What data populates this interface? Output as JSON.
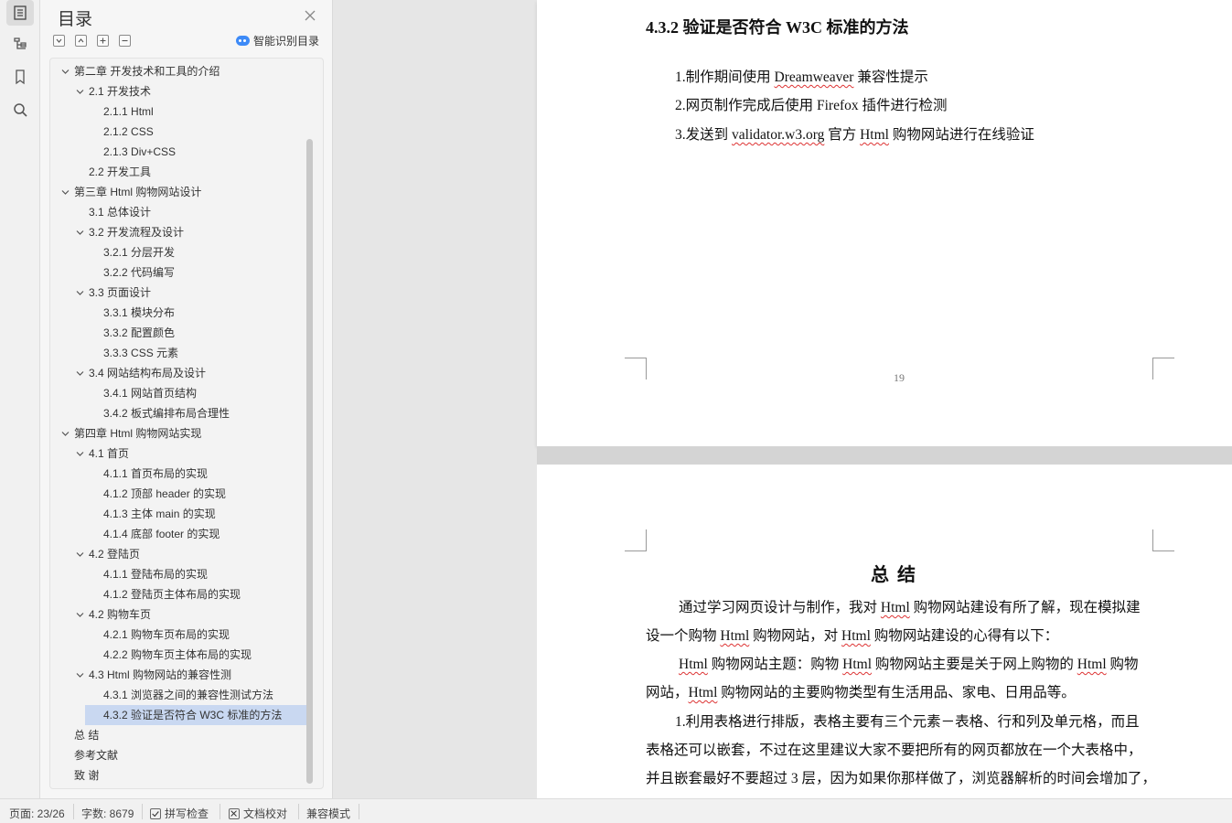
{
  "toc": {
    "title": "目录",
    "smart_label": "智能识别目录",
    "items": [
      {
        "label": "第二章  开发技术和工具的介绍",
        "level": 0,
        "expanded": true
      },
      {
        "label": "2.1 开发技术",
        "level": 1,
        "expanded": true
      },
      {
        "label": "2.1.1 Html",
        "level": 2
      },
      {
        "label": "2.1.2 CSS",
        "level": 2
      },
      {
        "label": "2.1.3 Div+CSS",
        "level": 2
      },
      {
        "label": "2.2 开发工具",
        "level": 1
      },
      {
        "label": "第三章  Html 购物网站设计",
        "level": 0,
        "expanded": true
      },
      {
        "label": "3.1 总体设计",
        "level": 1
      },
      {
        "label": "3.2 开发流程及设计",
        "level": 1,
        "expanded": true
      },
      {
        "label": "3.2.1  分层开发",
        "level": 2
      },
      {
        "label": "3.2.2  代码编写",
        "level": 2
      },
      {
        "label": "3.3 页面设计",
        "level": 1,
        "expanded": true
      },
      {
        "label": "3.3.1 模块分布",
        "level": 2
      },
      {
        "label": "3.3.2  配置颜色",
        "level": 2
      },
      {
        "label": "3.3.3 CSS 元素",
        "level": 2
      },
      {
        "label": "3.4 网站结构布局及设计",
        "level": 1,
        "expanded": true
      },
      {
        "label": "3.4.1  网站首页结构",
        "level": 2
      },
      {
        "label": "3.4.2  板式编排布局合理性",
        "level": 2
      },
      {
        "label": "第四章  Html 购物网站实现",
        "level": 0,
        "expanded": true
      },
      {
        "label": "4.1 首页",
        "level": 1,
        "expanded": true
      },
      {
        "label": "4.1.1 首页布局的实现",
        "level": 2
      },
      {
        "label": "4.1.2  顶部 header 的实现",
        "level": 2
      },
      {
        "label": "4.1.3  主体 main 的实现",
        "level": 2
      },
      {
        "label": "4.1.4  底部 footer 的实现",
        "level": 2
      },
      {
        "label": "4.2  登陆页",
        "level": 1,
        "expanded": true
      },
      {
        "label": "4.1.1 登陆布局的实现",
        "level": 2
      },
      {
        "label": "4.1.2 登陆页主体布局的实现",
        "level": 2
      },
      {
        "label": "4.2  购物车页",
        "level": 1,
        "expanded": true
      },
      {
        "label": "4.2.1 购物车页布局的实现",
        "level": 2
      },
      {
        "label": "4.2.2 购物车页主体布局的实现",
        "level": 2
      },
      {
        "label": "4.3 Html 购物网站的兼容性测",
        "level": 1,
        "expanded": true
      },
      {
        "label": "4.3.1 浏览器之间的兼容性测试方法",
        "level": 2
      },
      {
        "label": "4.3.2 验证是否符合 W3C 标准的方法",
        "level": 2,
        "selected": true
      },
      {
        "label": "总   结",
        "level": 0,
        "leaf": true
      },
      {
        "label": "参考文献",
        "level": 0,
        "leaf": true
      },
      {
        "label": "致   谢",
        "level": 0,
        "leaf": true
      }
    ]
  },
  "page1": {
    "heading": "4.3.2 验证是否符合 W3C 标准的方法",
    "line1": {
      "a": "1.制作期间使用 ",
      "b": "Dreamweaver",
      "c": " 兼容性提示"
    },
    "line2": "2.网页制作完成后使用 Firefox 插件进行检测",
    "line3": {
      "a": "3.发送到 ",
      "b": "validator.w3.org",
      "c": " 官方 ",
      "d": "Html",
      "e": " 购物网站进行在线验证"
    },
    "page_number": "19"
  },
  "page2": {
    "title": "总   结",
    "l1": {
      "a": "通过学习网页设计与制作，我对 ",
      "b": "Html",
      "c": " 购物网站建设有所了解，现在模拟建"
    },
    "l2": {
      "a": "设一个购物 ",
      "b": "Html",
      "c": " 购物网站，对 ",
      "d": "Html",
      "e": " 购物网站建设的心得有以下："
    },
    "l3": {
      "a": "Html",
      "b": " 购物网站主题：购物 ",
      "c": "Html",
      "d": " 购物网站主要是关于网上购物的 ",
      "e": "Html",
      "f": " 购物"
    },
    "l4": {
      "a": "网站，",
      "b": "Html",
      "c": " 购物网站的主要购物类型有生活用品、家电、日用品等。"
    },
    "l5": "1.利用表格进行排版，表格主要有三个元素－表格、行和列及单元格，而且",
    "l6": "表格还可以嵌套，不过在这里建议大家不要把所有的网页都放在一个大表格中，",
    "l7": "并且嵌套最好不要超过 3 层，因为如果你那样做了，浏览器解析的时间会增加了，"
  },
  "status": {
    "page": "页面: 23/26",
    "words": "字数: 8679",
    "spell": "拼写检查",
    "proof": "文档校对",
    "compat": "兼容模式"
  }
}
